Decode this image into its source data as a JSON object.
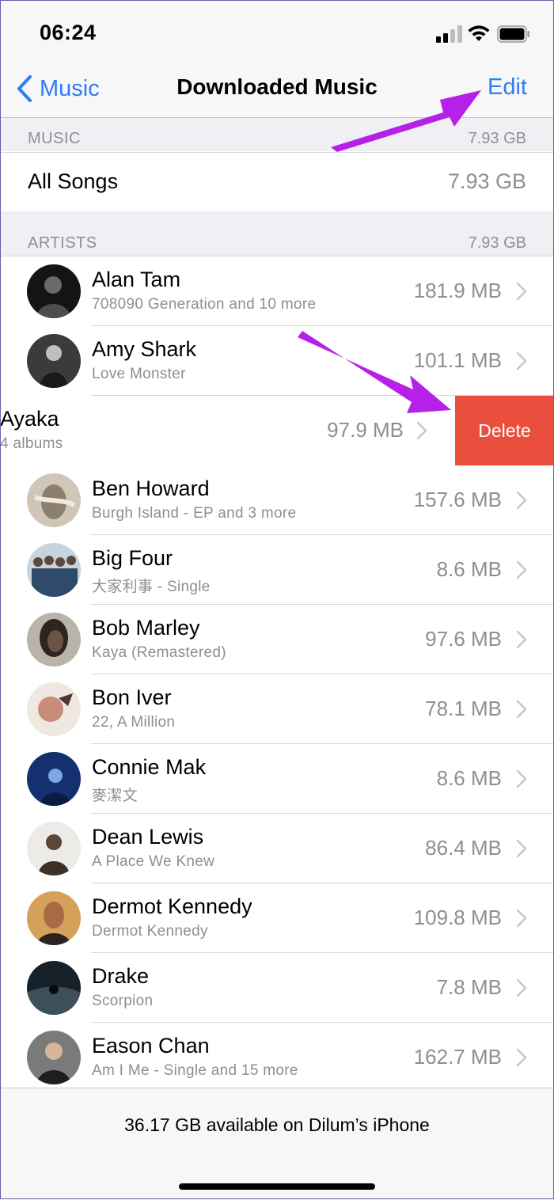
{
  "status": {
    "time": "06:24"
  },
  "nav": {
    "back_label": "Music",
    "title": "Downloaded Music",
    "edit_label": "Edit"
  },
  "music_section": {
    "header": "MUSIC",
    "size": "7.93 GB",
    "all_songs_label": "All Songs",
    "all_songs_size": "7.93 GB"
  },
  "artists_section": {
    "header": "ARTISTS",
    "size": "7.93 GB"
  },
  "artists": [
    {
      "name": "Alan Tam",
      "subtitle": "708090 Generation and 10 more",
      "size": "181.9 MB",
      "avatar_color": "#3a3a3a"
    },
    {
      "name": "Amy Shark",
      "subtitle": "Love Monster",
      "size": "101.1 MB",
      "avatar_color": "#555555"
    },
    {
      "name": "Ayaka",
      "subtitle": "4 albums",
      "size": "97.9 MB",
      "avatar_color": "#8a8a8a"
    },
    {
      "name": "Ben Howard",
      "subtitle": "Burgh Island - EP and 3 more",
      "size": "157.6 MB",
      "avatar_color": "#a79c8c"
    },
    {
      "name": "Big Four",
      "subtitle": "大家利事 - Single",
      "size": "8.6 MB",
      "avatar_color": "#6f7d8c"
    },
    {
      "name": "Bob Marley",
      "subtitle": "Kaya (Remastered)",
      "size": "97.6 MB",
      "avatar_color": "#4a3f35"
    },
    {
      "name": "Bon Iver",
      "subtitle": "22, A Million",
      "size": "78.1 MB",
      "avatar_color": "#d9cfc6"
    },
    {
      "name": "Connie Mak",
      "subtitle": "麥潔文",
      "size": "8.6 MB",
      "avatar_color": "#1d3a7a"
    },
    {
      "name": "Dean Lewis",
      "subtitle": "A Place We Knew",
      "size": "86.4 MB",
      "avatar_color": "#6b5a48"
    },
    {
      "name": "Dermot Kennedy",
      "subtitle": "Dermot Kennedy",
      "size": "109.8 MB",
      "avatar_color": "#c08040"
    },
    {
      "name": "Drake",
      "subtitle": "Scorpion",
      "size": "7.8 MB",
      "avatar_color": "#1f2a33"
    },
    {
      "name": "Eason Chan",
      "subtitle": "Am I Me - Single and 15 more",
      "size": "162.7 MB",
      "avatar_color": "#5e5e5e"
    }
  ],
  "swipe_action": {
    "label": "Delete",
    "color": "#ea4e3d"
  },
  "footer": {
    "text": "36.17 GB available on Dilum’s iPhone"
  },
  "accent_color": "#2f7cf6",
  "annotation_color": "#b620e8"
}
